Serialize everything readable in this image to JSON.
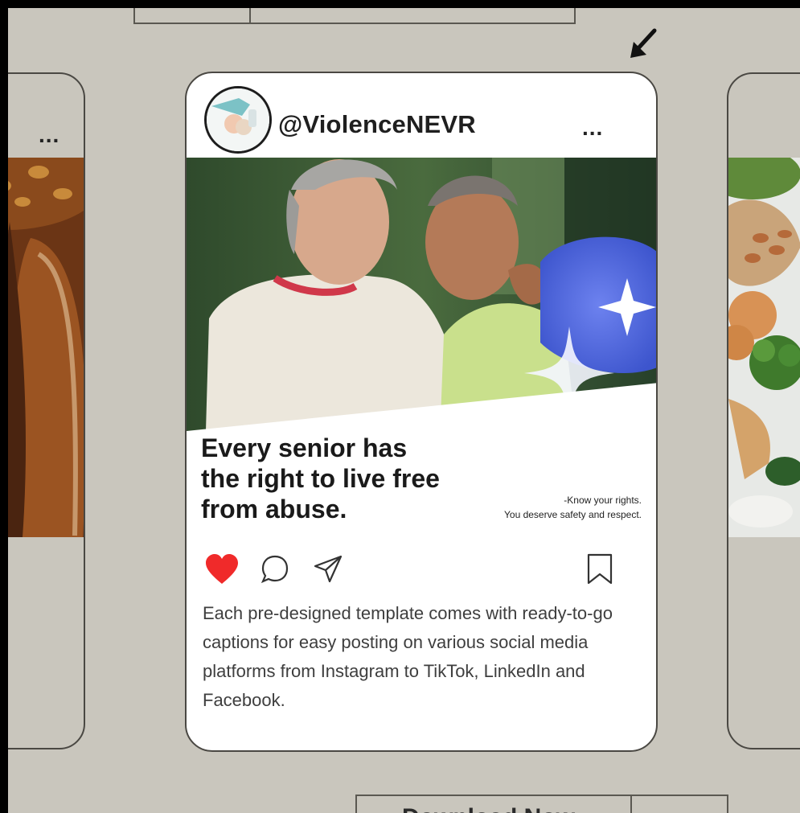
{
  "post": {
    "username": "@ViolenceNEVR",
    "menu_glyph": "...",
    "headline": "Every senior has the right to live free from abuse.",
    "tagline_line1": "-Know your rights.",
    "tagline_line2": "You deserve safety and respect.",
    "caption": "Each pre-designed template comes with ready-to-go captions for easy posting on various social media platforms from Instagram to TikTok, LinkedIn and Facebook.",
    "liked": true
  },
  "side_cards": {
    "left_menu_glyph": "...",
    "right_image": "vegetables-nuts-photo",
    "left_image": "bread-loaves-photo"
  },
  "footer": {
    "download_label": "Download Now"
  },
  "colors": {
    "background": "#c9c6bd",
    "like_red": "#f02a2a",
    "accent_blue": "#4b5fd0"
  },
  "icons": [
    "heart-icon",
    "comment-icon",
    "share-icon",
    "bookmark-icon",
    "arrow-pointer-icon",
    "more-icon"
  ]
}
